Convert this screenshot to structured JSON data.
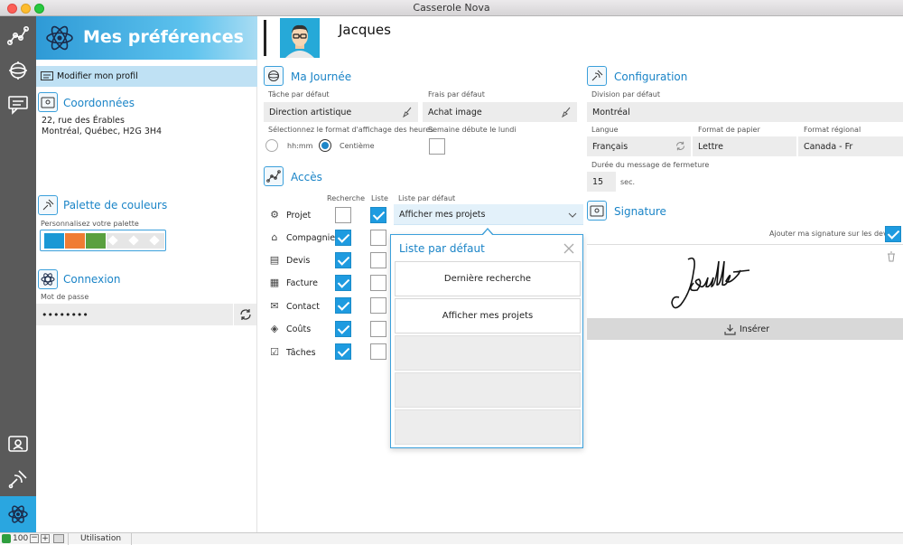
{
  "window": {
    "title": "Casserole Nova"
  },
  "sidebar_rail": {
    "icons": [
      "network-icon",
      "gear-globe-icon",
      "chat-icon",
      "contact-card-icon",
      "satellite-icon",
      "atom-icon"
    ]
  },
  "left": {
    "banner_title": "Mes préférences",
    "edit_profile": "Modifier mon profil",
    "coordonnees": {
      "title": "Coordonnées",
      "line1": "22, rue des Érables",
      "line2": "Montréal, Québec, H2G 3H4"
    },
    "palette": {
      "title": "Palette de couleurs",
      "label": "Personnalisez votre palette",
      "colors": [
        "#1a98d5",
        "#f07c33",
        "#5aa03f"
      ]
    },
    "connexion": {
      "title": "Connexion",
      "password_label": "Mot de passe",
      "password_value": "••••••••"
    }
  },
  "header": {
    "user_name": "Jacques"
  },
  "journee": {
    "title": "Ma Journée",
    "task_label": "Tâche par défaut",
    "task_value": "Direction artistique",
    "fees_label": "Frais par défaut",
    "fees_value": "Achat image",
    "hours_label": "Sélectionnez le format d'affichage des heures",
    "opt_hhmm": "hh:mm",
    "opt_centieme": "Centième",
    "week_label": "Semaine débute le lundi"
  },
  "acces": {
    "title": "Accès",
    "col_recherche": "Recherche",
    "col_liste": "Liste",
    "col_default": "Liste par défaut",
    "default_value": "Afficher mes projets",
    "rows": [
      {
        "label": "Projet",
        "recherche": false,
        "liste": true
      },
      {
        "label": "Compagnie",
        "recherche": true,
        "liste": false
      },
      {
        "label": "Devis",
        "recherche": true,
        "liste": false
      },
      {
        "label": "Facture",
        "recherche": true,
        "liste": false
      },
      {
        "label": "Contact",
        "recherche": true,
        "liste": false
      },
      {
        "label": "Coûts",
        "recherche": true,
        "liste": false
      },
      {
        "label": "Tâches",
        "recherche": true,
        "liste": false
      }
    ]
  },
  "popover": {
    "title": "Liste par défaut",
    "items": [
      "Dernière recherche",
      "Afficher mes projets"
    ]
  },
  "config": {
    "title": "Configuration",
    "division_label": "Division par défaut",
    "division_value": "Montréal",
    "langue_label": "Langue",
    "langue_value": "Français",
    "papier_label": "Format de papier",
    "papier_value": "Lettre",
    "regional_label": "Format régional",
    "regional_value": "Canada - Fr",
    "closing_label": "Durée du message de fermeture",
    "closing_value": "15",
    "closing_unit": "sec."
  },
  "signature": {
    "title": "Signature",
    "add_label": "Ajouter ma signature sur les devis",
    "insert_label": "Insérer"
  },
  "status": {
    "zoom": "100",
    "mode": "Utilisation"
  }
}
